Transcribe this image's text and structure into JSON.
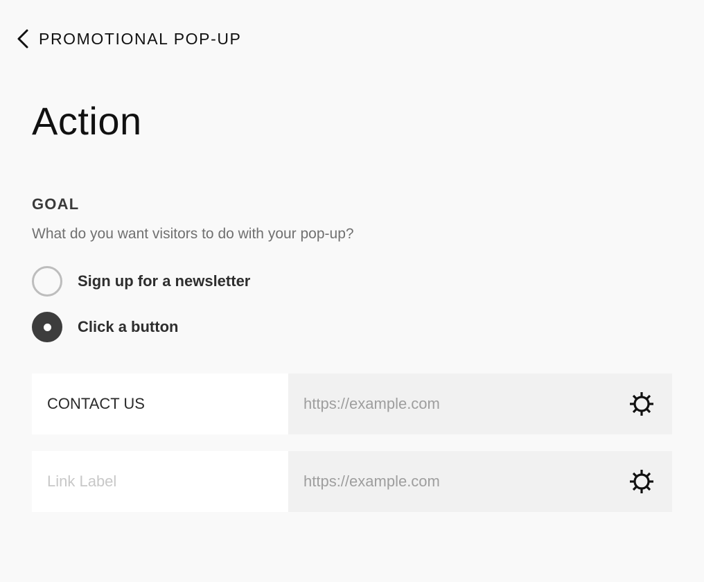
{
  "header": {
    "back_icon": "chevron-left-icon",
    "title": "PROMOTIONAL POP-UP"
  },
  "page": {
    "title": "Action"
  },
  "goal": {
    "label": "GOAL",
    "description": "What do you want visitors to do with your pop-up?",
    "options": [
      {
        "label": "Sign up for a newsletter",
        "selected": false
      },
      {
        "label": "Click a button",
        "selected": true
      }
    ]
  },
  "links": [
    {
      "label_value": "CONTACT US",
      "label_placeholder": "",
      "url_placeholder": "https://example.com",
      "settings_icon": "gear-icon"
    },
    {
      "label_value": "",
      "label_placeholder": "Link Label",
      "url_placeholder": "https://example.com",
      "settings_icon": "gear-icon"
    }
  ],
  "colors": {
    "background": "#f9f9f9",
    "radio_checked": "#3d3d3d",
    "radio_unchecked_border": "#bdbdbd",
    "url_field_bg": "#f1f1f1",
    "label_field_bg": "#ffffff"
  }
}
